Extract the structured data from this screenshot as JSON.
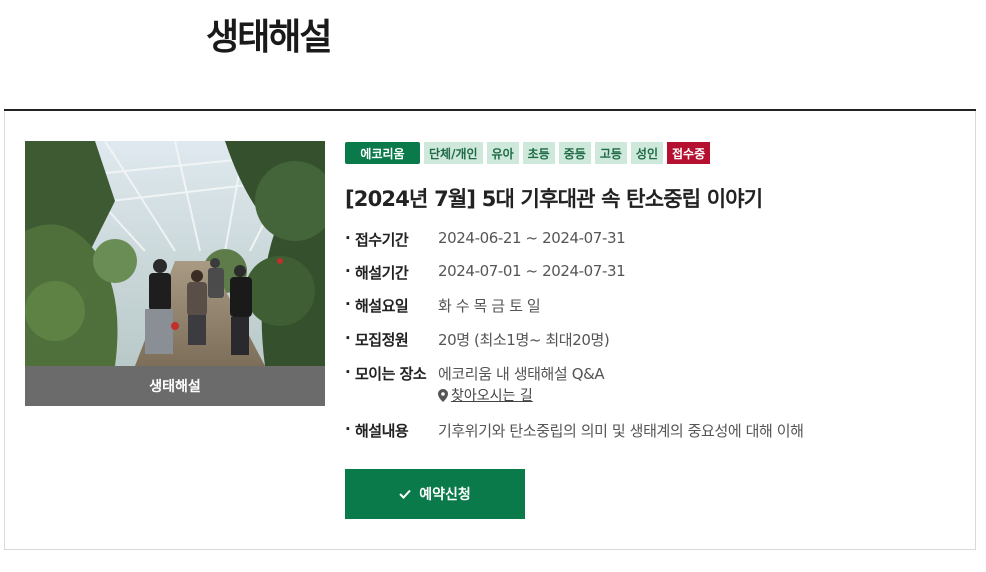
{
  "page": {
    "title": "생태해설"
  },
  "program": {
    "thumbnail_caption": "생태해설",
    "tags": {
      "venue": "에코리움",
      "type": "단체/개인",
      "infant": "유아",
      "elementary": "초등",
      "middle": "중등",
      "high": "고등",
      "adult": "성인",
      "status": "접수중"
    },
    "title": "[2024년 7월] 5대 기후대관 속 탄소중립 이야기",
    "details": {
      "registration": {
        "label": "접수기간",
        "value": "2024-06-21 ~ 2024-07-31"
      },
      "session": {
        "label": "해설기간",
        "value": "2024-07-01 ~ 2024-07-31"
      },
      "days": {
        "label": "해설요일",
        "value": "화 수 목 금 토 일"
      },
      "capacity": {
        "label": "모집정원",
        "value": "20명 (최소1명~ 최대20명)"
      },
      "meeting": {
        "label": "모이는 장소",
        "value": "에코리움 내 생태해설 Q&A"
      },
      "content": {
        "label": "해설내용",
        "value": "기후위기와 탄소중립의 의미 및 생태계의 중요성에 대해 이해"
      }
    },
    "directions_link": "찾아오시는 길",
    "reserve_button": "예약신청"
  },
  "colors": {
    "brand_green": "#0a7a4a",
    "tag_bg": "#cfe8dc",
    "status_red": "#b5102f"
  },
  "icons": {
    "location": "map-pin-icon",
    "check": "check-icon"
  }
}
